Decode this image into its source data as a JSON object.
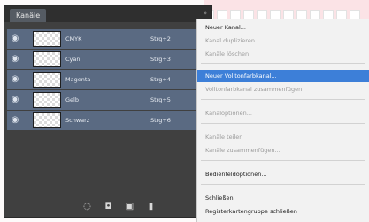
{
  "panel": {
    "tab_label": "Kanäle",
    "collapse_glyph": "»",
    "channels": [
      {
        "name": "CMYK",
        "shortcut": "Strg+2"
      },
      {
        "name": "Cyan",
        "shortcut": "Strg+3"
      },
      {
        "name": "Magenta",
        "shortcut": "Strg+4"
      },
      {
        "name": "Gelb",
        "shortcut": "Strg+5"
      },
      {
        "name": "Schwarz",
        "shortcut": "Strg+6"
      }
    ],
    "icons": [
      "dotted-circle-icon",
      "load-selection-icon",
      "new-channel-icon",
      "delete-icon"
    ]
  },
  "menu": {
    "items": [
      {
        "label": "Neuer Kanal...",
        "state": "enabled"
      },
      {
        "label": "Kanal duplizieren...",
        "state": "disabled"
      },
      {
        "label": "Kanäle löschen",
        "state": "disabled"
      },
      {
        "label": "Neuer Volltonfarbkanal...",
        "state": "highlighted"
      },
      {
        "label": "Volltonfarbkanal zusammenfügen",
        "state": "disabled"
      },
      {
        "label": "Kanaloptionen...",
        "state": "disabled"
      },
      {
        "label": "Kanäle teilen",
        "state": "disabled"
      },
      {
        "label": "Kanäle zusammenfügen...",
        "state": "disabled"
      },
      {
        "label": "Bedienfeldoptionen...",
        "state": "enabled"
      },
      {
        "label": "Schließen",
        "state": "enabled"
      },
      {
        "label": "Registerkartengruppe schließen",
        "state": "enabled"
      }
    ]
  },
  "colors": {
    "highlight": "#3d7fd8",
    "row": "#5a6a82",
    "panel": "#404040"
  }
}
